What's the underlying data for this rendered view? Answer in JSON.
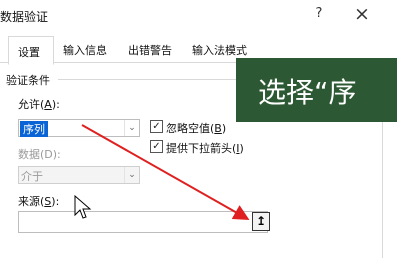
{
  "dialog": {
    "title": "数据验证",
    "help": "?",
    "close": "×"
  },
  "tabs": [
    {
      "label": "设置",
      "active": true
    },
    {
      "label": "输入信息",
      "active": false
    },
    {
      "label": "出错警告",
      "active": false
    },
    {
      "label": "输入法模式",
      "active": false
    }
  ],
  "validation": {
    "group_label": "验证条件",
    "allow": {
      "label_pre": "允许(",
      "label_key": "A",
      "label_post": "):",
      "value": "序列"
    },
    "data": {
      "label": "数据(D):",
      "value": "介于"
    },
    "ignore_blank": {
      "label_pre": "忽略空值(",
      "label_key": "B",
      "label_post": ")",
      "checked": true
    },
    "dropdown_arrow": {
      "label_pre": "提供下拉箭头(",
      "label_key": "I",
      "label_post": ")",
      "checked": true
    },
    "source": {
      "label_pre": "来源(",
      "label_key": "S",
      "label_post": "):",
      "value": ""
    },
    "collapse_button": "↥"
  },
  "overlay": {
    "banner_text": "选择“序",
    "arrow_color": "#e02020",
    "banner_color": "#2c5834"
  },
  "icons": {
    "dropdown": "chevron-down-icon",
    "checkbox": "check-icon",
    "collapse": "collapse-dialog-icon",
    "cursor": "mouse-pointer-icon"
  }
}
